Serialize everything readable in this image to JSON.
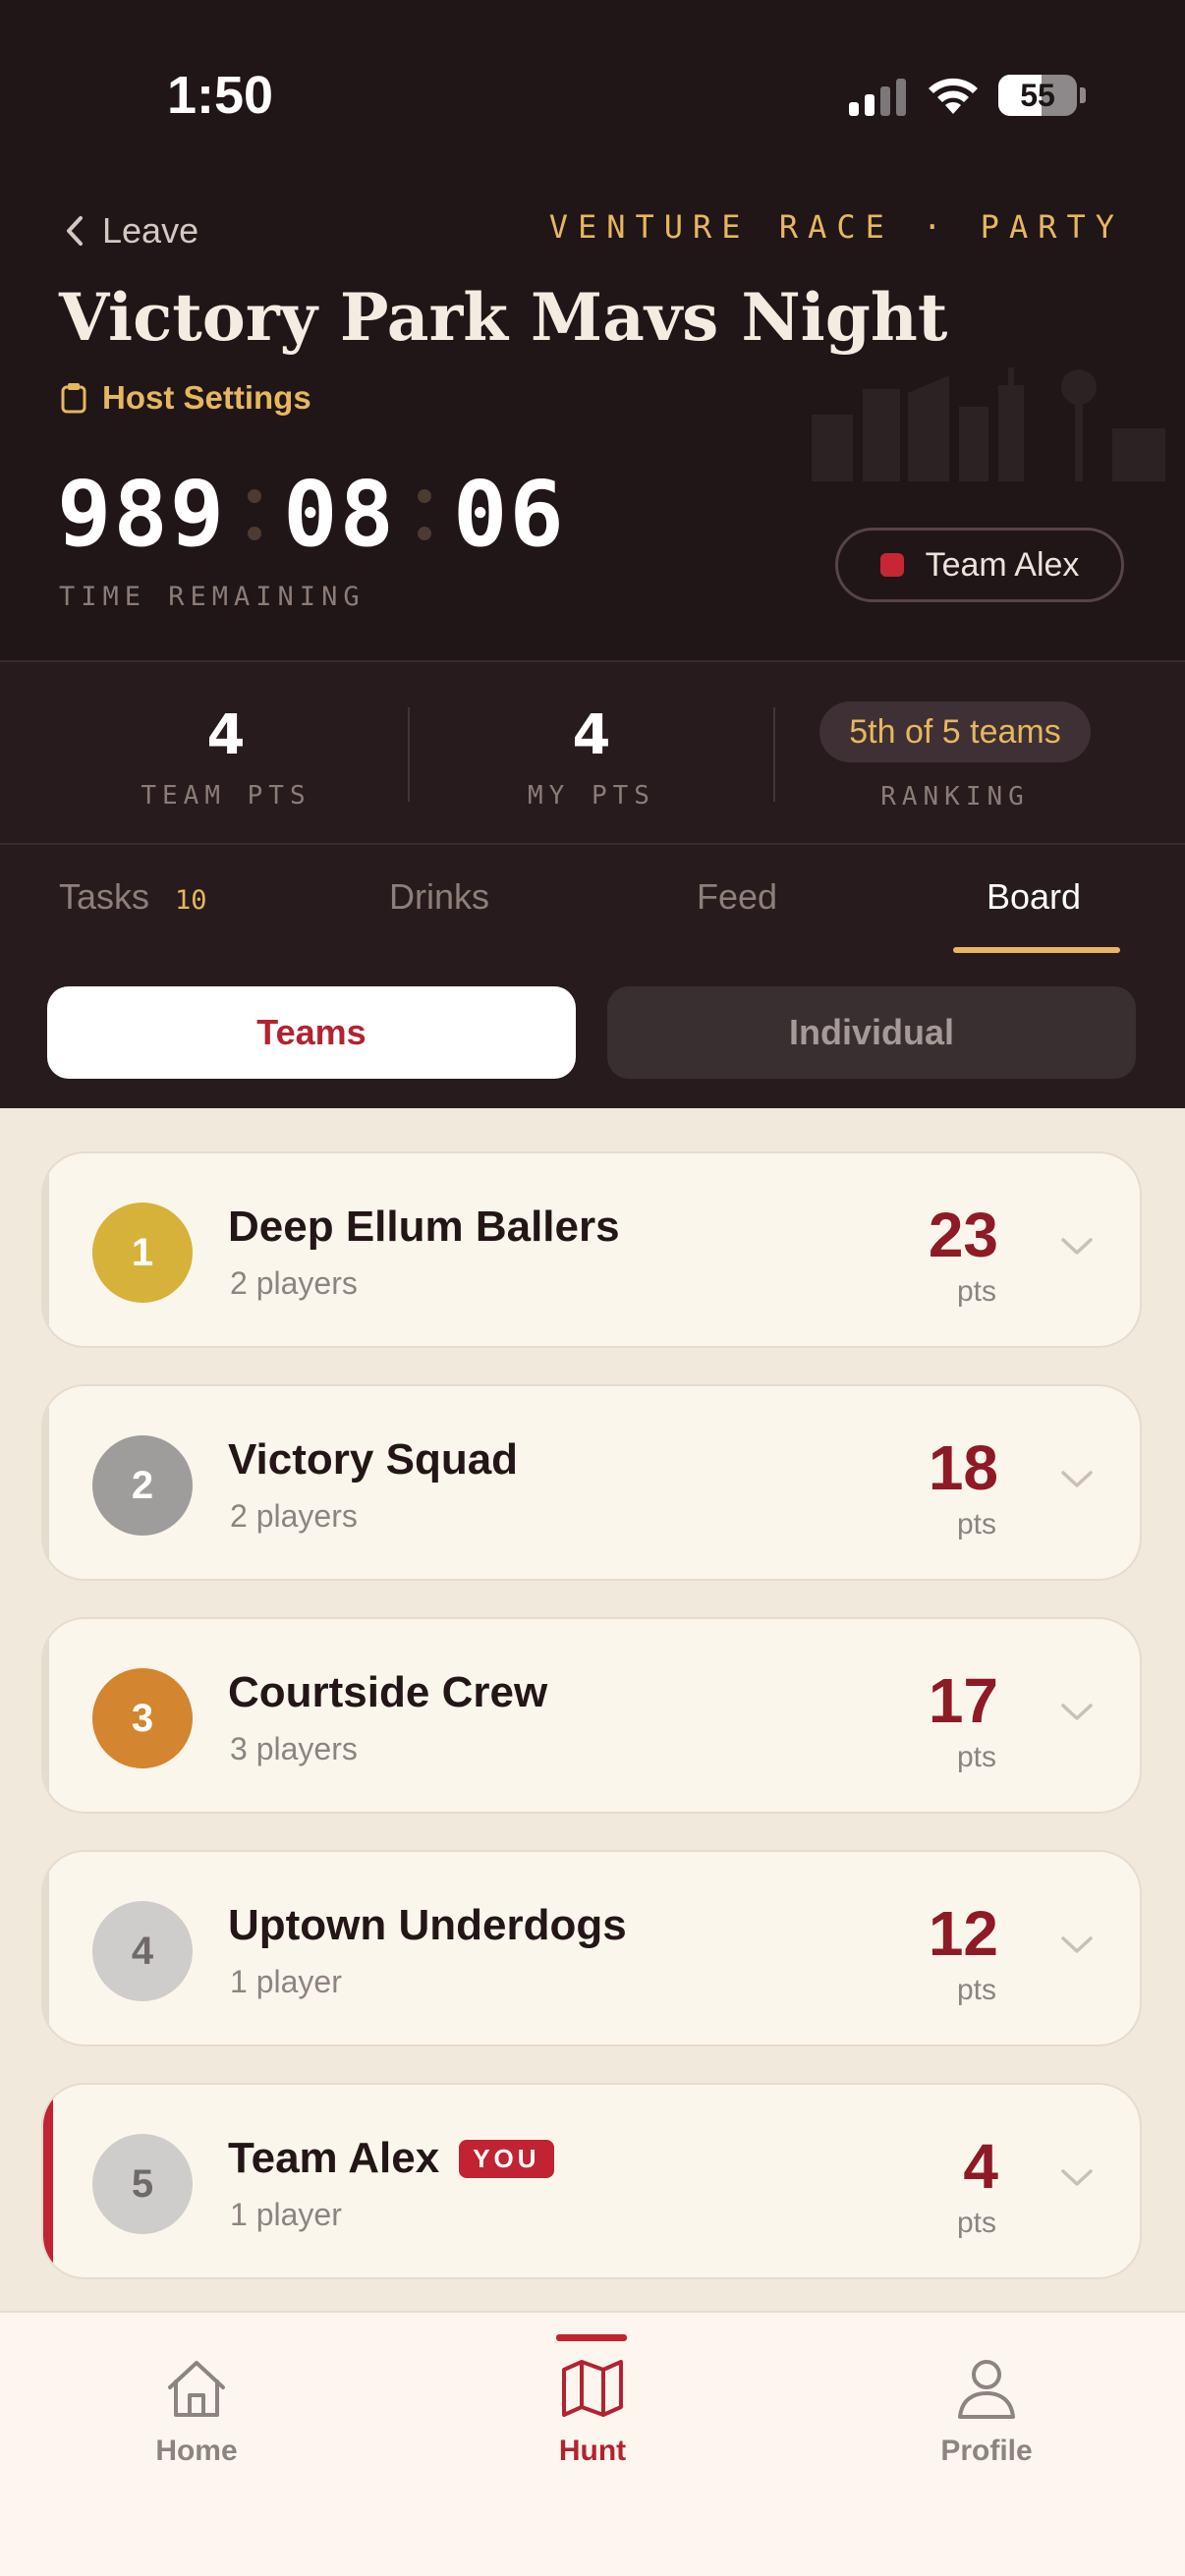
{
  "status_bar": {
    "time": "1:50",
    "battery": "55",
    "battery_level": 0.55
  },
  "header": {
    "leave_label": "Leave",
    "tagline": "VENTURE RACE · PARTY",
    "title": "Victory Park Mavs Night",
    "host_settings_label": "Host Settings",
    "timer": {
      "hours": "989",
      "minutes": "08",
      "seconds": "06",
      "label": "TIME REMAINING"
    },
    "team_pill": "Team Alex"
  },
  "stats": {
    "team_pts": {
      "value": "4",
      "label": "TEAM PTS"
    },
    "my_pts": {
      "value": "4",
      "label": "MY PTS"
    },
    "ranking": {
      "value": "5th of 5 teams",
      "label": "RANKING"
    }
  },
  "tabs": [
    {
      "label": "Tasks",
      "count": "10"
    },
    {
      "label": "Drinks"
    },
    {
      "label": "Feed"
    },
    {
      "label": "Board",
      "active": true
    }
  ],
  "segment": {
    "teams": "Teams",
    "individual": "Individual",
    "selected": "Teams"
  },
  "leaderboard": [
    {
      "rank": "1",
      "name": "Deep Ellum Ballers",
      "players": "2 players",
      "pts": "23",
      "pts_label": "pts",
      "color": "#d6b23a"
    },
    {
      "rank": "2",
      "name": "Victory Squad",
      "players": "2 players",
      "pts": "18",
      "pts_label": "pts",
      "color": "#9e9d9c"
    },
    {
      "rank": "3",
      "name": "Courtside Crew",
      "players": "3 players",
      "pts": "17",
      "pts_label": "pts",
      "color": "#d4852f"
    },
    {
      "rank": "4",
      "name": "Uptown Underdogs",
      "players": "1 player",
      "pts": "12",
      "pts_label": "pts",
      "color": "#cfcdcb"
    },
    {
      "rank": "5",
      "name": "Team Alex",
      "players": "1 player",
      "pts": "4",
      "pts_label": "pts",
      "color": "#cfcdcb",
      "you": "YOU"
    }
  ],
  "bottom_nav": [
    {
      "label": "Home",
      "icon": "home-icon"
    },
    {
      "label": "Hunt",
      "icon": "map-icon",
      "active": true
    },
    {
      "label": "Profile",
      "icon": "person-icon"
    }
  ],
  "colors": {
    "accent_red": "#c12332",
    "gold": "#e6b75e",
    "header_bg": "#201517",
    "content_bg": "#f1e9dc"
  }
}
